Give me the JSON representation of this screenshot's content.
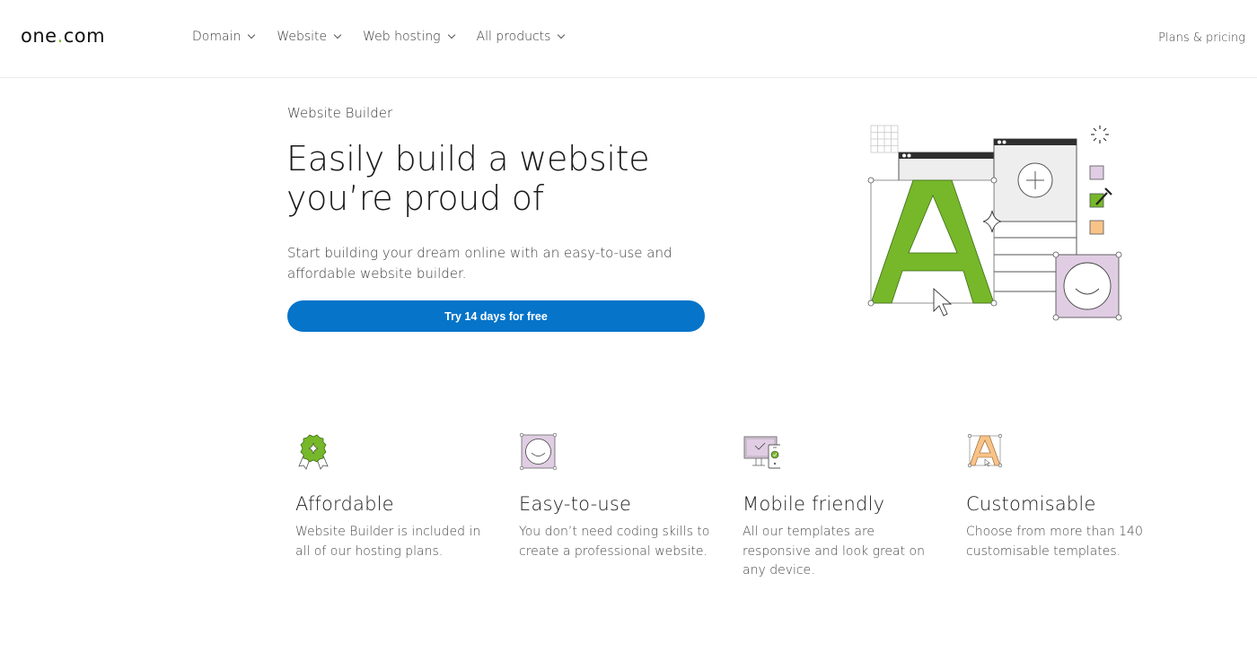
{
  "header": {
    "logo": {
      "text_before": "one",
      "dot": ".",
      "text_after": "com"
    },
    "nav": [
      {
        "label": "Domain",
        "icon": "chevron-down-icon"
      },
      {
        "label": "Website",
        "icon": "chevron-down-icon"
      },
      {
        "label": "Web hosting",
        "icon": "chevron-down-icon"
      },
      {
        "label": "All products",
        "icon": "chevron-down-icon"
      }
    ],
    "plans_link": "Plans & pricing"
  },
  "hero": {
    "eyebrow": "Website Builder",
    "headline_line1": "Easily build a website",
    "headline_line2": "you’re proud of",
    "subtext": "Start building your dream online with an easy-to-use and affordable website builder.",
    "cta_label": "Try 14 days for free",
    "illustration": "website-builder-illustration"
  },
  "features": [
    {
      "icon": "award-badge-icon",
      "title": "Affordable",
      "text": "Website Builder is included in all of our hosting plans."
    },
    {
      "icon": "smiley-frame-icon",
      "title": "Easy-to-use",
      "text": "You don’t need coding skills to create a professional website."
    },
    {
      "icon": "devices-icon",
      "title": "Mobile friendly",
      "text": "All our templates are responsive and look great on any device."
    },
    {
      "icon": "letter-a-frame-icon",
      "title": "Customisable",
      "text": "Choose from more than 140 customisable templates."
    }
  ],
  "colors": {
    "brand_green": "#76b82a",
    "cta_blue": "#0574c9",
    "lilac": "#e0cde3",
    "peach": "#f9c388"
  }
}
